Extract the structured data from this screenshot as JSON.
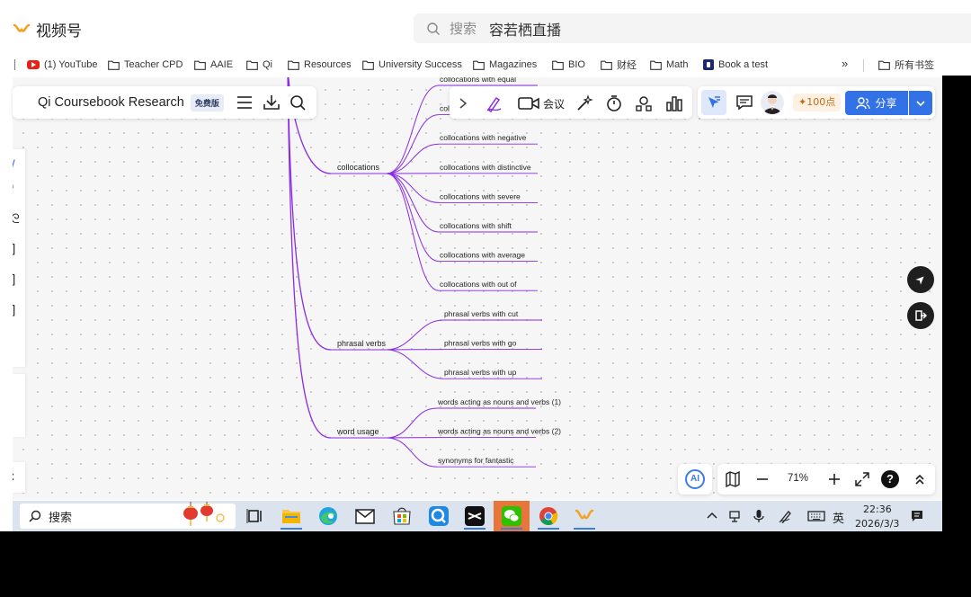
{
  "app": {
    "brand_name": "视频号"
  },
  "search": {
    "placeholder": "搜索",
    "query": "容若栖直播"
  },
  "bookmarks": [
    {
      "label": "(1) YouTube",
      "icon": "youtube-icon"
    },
    {
      "label": "Teacher CPD",
      "icon": "folder-icon"
    },
    {
      "label": "AAIE",
      "icon": "folder-icon"
    },
    {
      "label": "Qi",
      "icon": "folder-icon"
    },
    {
      "label": "Resources",
      "icon": "folder-icon"
    },
    {
      "label": "University Success",
      "icon": "folder-icon"
    },
    {
      "label": "Magazines",
      "icon": "folder-icon"
    },
    {
      "label": "BIO",
      "icon": "folder-icon"
    },
    {
      "label": "财经",
      "icon": "folder-icon"
    },
    {
      "label": "Math",
      "icon": "folder-icon"
    },
    {
      "label": "Book a test",
      "icon": "book-icon"
    }
  ],
  "bookmarks_more": "»",
  "bookmarks_all": "所有书签",
  "doc": {
    "title": "Qi Coursebook Research",
    "badge": "免费版"
  },
  "toolbar": {
    "meeting_label": "会议",
    "points_label": "100点",
    "share_label": "分享"
  },
  "mindmap": {
    "groups": [
      {
        "label": "collocations",
        "children": [
          "collocations with equal",
          "collocations with ...",
          "collocations with negative",
          "collocations with distinctive",
          "collocations with severe",
          "collocations with shift",
          "collocations with average",
          "collocations with out of"
        ]
      },
      {
        "label": "phrasal verbs",
        "children": [
          "phrasal verbs with cut",
          "phrasal verbs with go",
          "phrasal verbs with up"
        ]
      },
      {
        "label": "word usage",
        "children": [
          "words acting as nouns and verbs (1)",
          "words acting as nouns and verbs (2)",
          "synonyms for fantastic"
        ]
      }
    ],
    "branch_color": "#8a2be2"
  },
  "zoom": {
    "level": "71%",
    "help": "?",
    "ai": "AI"
  },
  "taskbar": {
    "search_label": "搜索",
    "ime": "英",
    "time": "22:36",
    "date": "2026/3/3"
  }
}
